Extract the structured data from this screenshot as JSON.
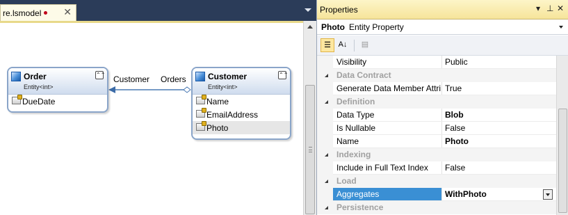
{
  "document_tab": {
    "title": "re.lsmodel",
    "close_label": "✕"
  },
  "diagram": {
    "entities": [
      {
        "name": "Order",
        "type": "Entity<int>",
        "properties": [
          "DueDate"
        ]
      },
      {
        "name": "Customer",
        "type": "Entity<int>",
        "properties": [
          "Name",
          "EmailAddress",
          "Photo"
        ],
        "selected_property": "Photo"
      }
    ],
    "association": {
      "role_left": "Customer",
      "role_right": "Orders"
    },
    "collapse_glyph": "⌃⌃"
  },
  "properties_panel": {
    "title": "Properties",
    "window_buttons": {
      "dropdown": "▾",
      "pin": "⊥",
      "close": "✕"
    },
    "object_name": "Photo",
    "object_type": "Entity Property",
    "toolbar": {
      "categorized_icon": "categorized-icon",
      "alphabetical_icon": "sort-az-icon",
      "pages_icon": "property-pages-icon",
      "alphabetical_glyph": "A↓",
      "pages_glyph": "▤",
      "categorized_glyph": "☰"
    },
    "rows": [
      {
        "kind": "prop",
        "name": "Visibility",
        "value": "Public"
      },
      {
        "kind": "cat",
        "name": "Data Contract"
      },
      {
        "kind": "prop",
        "name": "Generate Data Member Attrib",
        "value": "True"
      },
      {
        "kind": "cat",
        "name": "Definition"
      },
      {
        "kind": "prop",
        "name": "Data Type",
        "value": "Blob",
        "bold": true
      },
      {
        "kind": "prop",
        "name": "Is Nullable",
        "value": "False"
      },
      {
        "kind": "prop",
        "name": "Name",
        "value": "Photo",
        "bold": true
      },
      {
        "kind": "cat",
        "name": "Indexing"
      },
      {
        "kind": "prop",
        "name": "Include in Full Text Index",
        "value": "False"
      },
      {
        "kind": "cat",
        "name": "Load"
      },
      {
        "kind": "prop",
        "name": "Aggregates",
        "value": "WithPhoto",
        "selected": true
      },
      {
        "kind": "cat",
        "name": "Persistence"
      }
    ]
  },
  "colors": {
    "accent_selection": "#3a8fd4",
    "ide_background": "#2b3c59",
    "tab_dirty": "#c0001a",
    "panel_titlebar": "#f6e49a"
  }
}
